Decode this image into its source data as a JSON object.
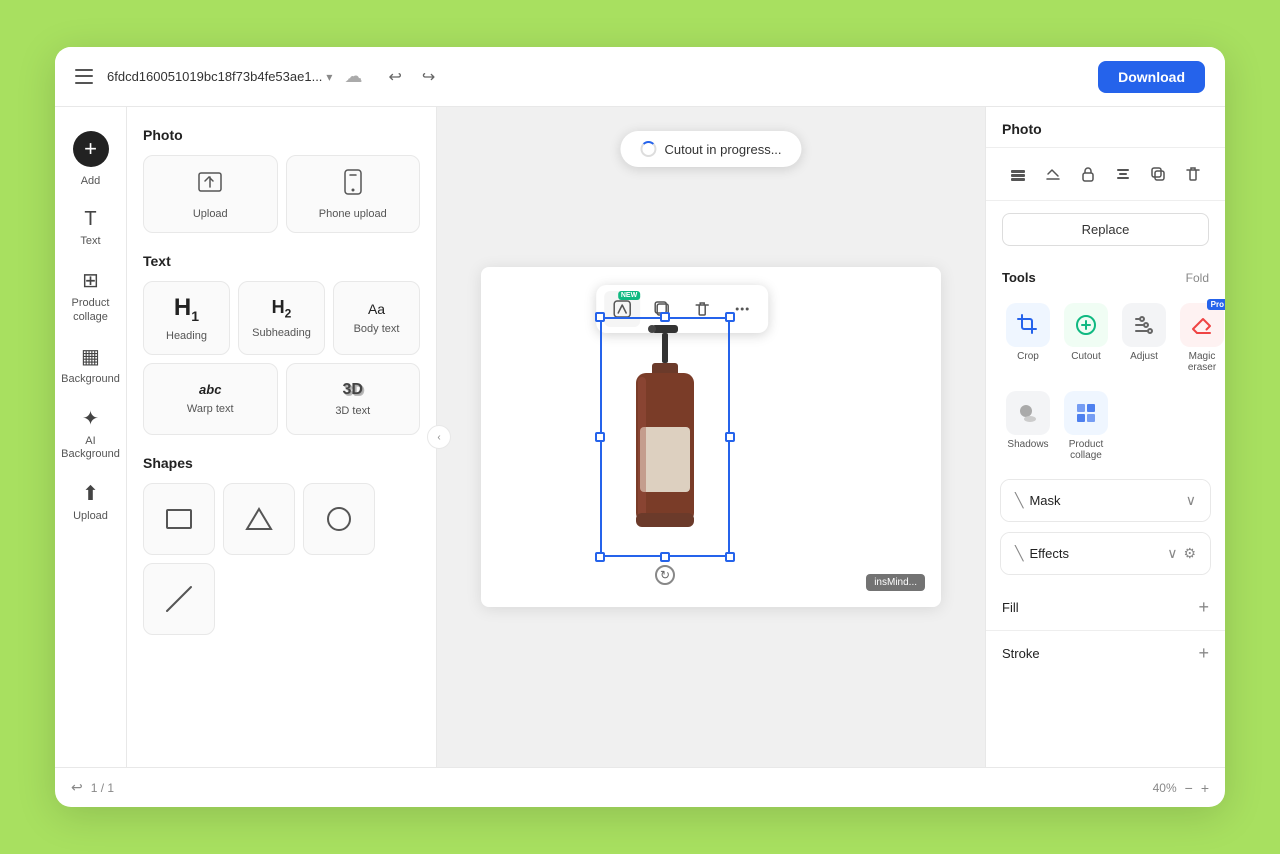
{
  "header": {
    "hamburger_label": "menu",
    "file_title": "6fdcd160051019bc18f73b4fe53ae1...",
    "download_label": "Download",
    "undo_icon": "↩",
    "redo_icon": "↪"
  },
  "left_toolbar": {
    "add_label": "Add",
    "text_label": "Text",
    "product_collage_label": "Product collage",
    "background_label": "Background",
    "ai_background_label": "AI Background",
    "upload_label": "Upload"
  },
  "left_panel": {
    "photo_section": "Photo",
    "photo_items": [
      {
        "label": "Upload",
        "icon": "upload"
      },
      {
        "label": "Phone upload",
        "icon": "phone"
      }
    ],
    "text_section": "Text",
    "text_items": [
      {
        "label": "Heading",
        "style": "heading"
      },
      {
        "label": "Subheading",
        "style": "subheading"
      },
      {
        "label": "Body text",
        "style": "body"
      },
      {
        "label": "Warp text",
        "style": "warp"
      },
      {
        "label": "3D text",
        "style": "threed"
      }
    ],
    "shapes_section": "Shapes"
  },
  "canvas": {
    "cutout_toast": "Cutout in progress...",
    "watermark": "insMind..."
  },
  "right_panel": {
    "title": "Photo",
    "replace_label": "Replace",
    "tools_title": "Tools",
    "fold_label": "Fold",
    "tools": [
      {
        "label": "Crop",
        "color": "blue"
      },
      {
        "label": "Cutout",
        "color": "green"
      },
      {
        "label": "Adjust",
        "color": "gray"
      },
      {
        "label": "Magic eraser",
        "color": "red",
        "pro": true
      },
      {
        "label": "Shadows",
        "color": "shadow"
      },
      {
        "label": "Product collage",
        "color": "collage"
      }
    ],
    "mask_label": "Mask",
    "effects_label": "Effects",
    "fill_label": "Fill",
    "stroke_label": "Stroke"
  }
}
